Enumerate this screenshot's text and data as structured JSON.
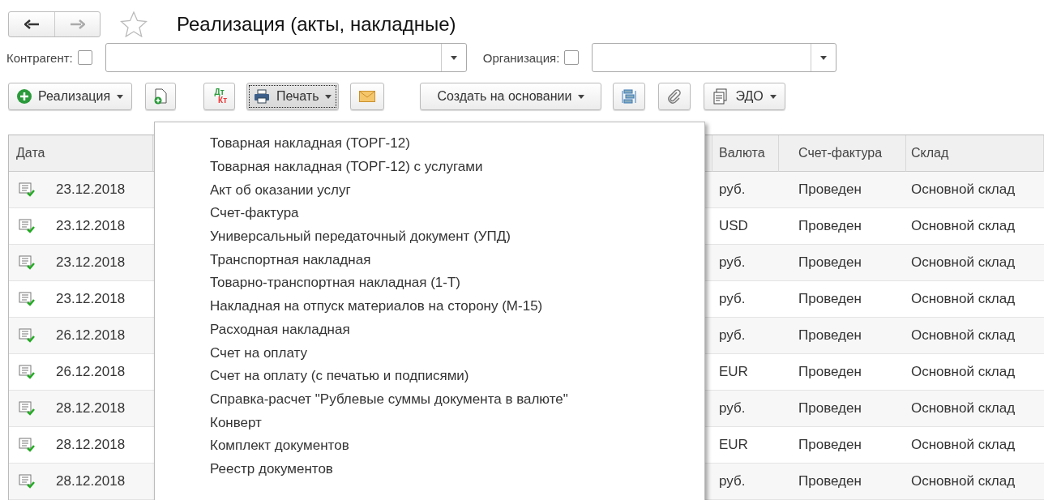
{
  "window": {
    "title": "Реализация (акты, накладные)",
    "favorite": false
  },
  "filters": [
    {
      "label": "Контрагент:",
      "checked": false
    },
    {
      "label": "Организация:",
      "checked": false
    }
  ],
  "toolbar": [
    {
      "kind": "create",
      "label": "Реализация",
      "dropdown": true
    },
    {
      "kind": "copy"
    },
    {
      "kind": "dtkt",
      "label_top": "Дт",
      "label_bottom": "Кт"
    },
    {
      "kind": "print",
      "label": "Печать",
      "dropdown": true,
      "selected": true
    },
    {
      "kind": "mail"
    },
    {
      "kind": "text",
      "label": "Создать на основании",
      "dropdown": true
    },
    {
      "kind": "structure"
    },
    {
      "kind": "attach"
    },
    {
      "kind": "edo",
      "label": "ЭДО",
      "dropdown": true
    }
  ],
  "table": {
    "columns": [
      "Дата",
      "Валюта",
      "Счет-фактура",
      "Склад"
    ],
    "rows": [
      {
        "date": "23.12.2018",
        "currency": "руб.",
        "invoice": "Проведен",
        "warehouse": "Основной склад",
        "posted": true
      },
      {
        "date": "23.12.2018",
        "currency": "USD",
        "invoice": "Проведен",
        "warehouse": "Основной склад",
        "posted": true
      },
      {
        "date": "23.12.2018",
        "currency": "руб.",
        "invoice": "Проведен",
        "warehouse": "Основной склад",
        "posted": true
      },
      {
        "date": "23.12.2018",
        "currency": "руб.",
        "invoice": "Проведен",
        "warehouse": "Основной склад",
        "posted": true
      },
      {
        "date": "26.12.2018",
        "currency": "руб.",
        "invoice": "Проведен",
        "warehouse": "Основной склад",
        "posted": true
      },
      {
        "date": "26.12.2018",
        "currency": "EUR",
        "invoice": "Проведен",
        "warehouse": "Основной склад",
        "posted": true
      },
      {
        "date": "28.12.2018",
        "currency": "руб.",
        "invoice": "Проведен",
        "warehouse": "Основной склад",
        "posted": true
      },
      {
        "date": "28.12.2018",
        "currency": "EUR",
        "invoice": "Проведен",
        "warehouse": "Основной склад",
        "posted": true
      },
      {
        "date": "28.12.2018",
        "currency": "руб.",
        "invoice": "Проведен",
        "warehouse": "Основной склад",
        "posted": true
      }
    ]
  },
  "print_menu": [
    "Товарная накладная (ТОРГ-12)",
    "Товарная накладная (ТОРГ-12) с услугами",
    "Акт об оказании услуг",
    "Счет-фактура",
    "Универсальный передаточный документ (УПД)",
    "Транспортная накладная",
    "Товарно-транспортная накладная (1-Т)",
    "Накладная на отпуск материалов на сторону (М-15)",
    "Расходная накладная",
    "Счет на оплату",
    "Счет на оплату (с печатью и подписями)",
    "Справка-расчет \"Рублевые суммы документа в валюте\"",
    "Конверт",
    "Комплект документов",
    "Реестр документов"
  ]
}
